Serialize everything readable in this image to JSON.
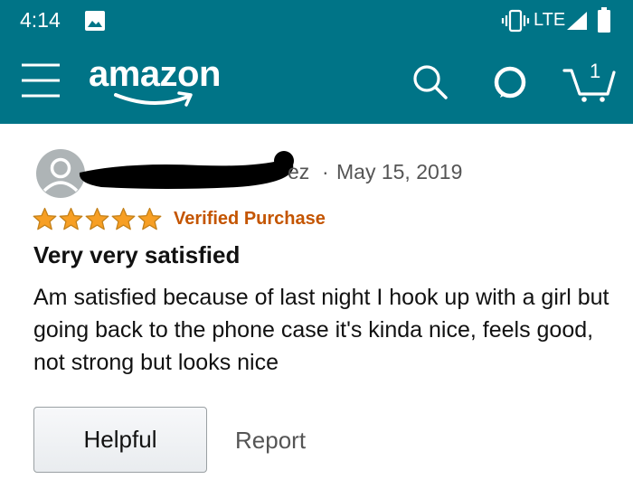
{
  "status_bar": {
    "time": "4:14",
    "network": "LTE",
    "icons": [
      "image-icon",
      "vibrate-icon",
      "signal-icon",
      "battery-icon"
    ]
  },
  "app_bar": {
    "logo": "amazon",
    "cart_count": "1",
    "icons": [
      "menu-icon",
      "search-icon",
      "alexa-icon",
      "cart-icon"
    ],
    "colors": {
      "background": "#007487",
      "foreground": "#ffffff"
    }
  },
  "review": {
    "author_visible": "ez",
    "separator": "·",
    "date": "May 15, 2019",
    "rating": 5,
    "rating_max": 5,
    "verified_label": "Verified Purchase",
    "title": "Very very satisfied",
    "body": "Am satisfied because of last night I hook up with a girl but going back to the phone case it's kinda nice, feels good, not strong but looks nice",
    "helpful_label": "Helpful",
    "report_label": "Report",
    "colors": {
      "star": "#f79f24",
      "verified": "#c45500",
      "meta_text": "#555555"
    }
  }
}
